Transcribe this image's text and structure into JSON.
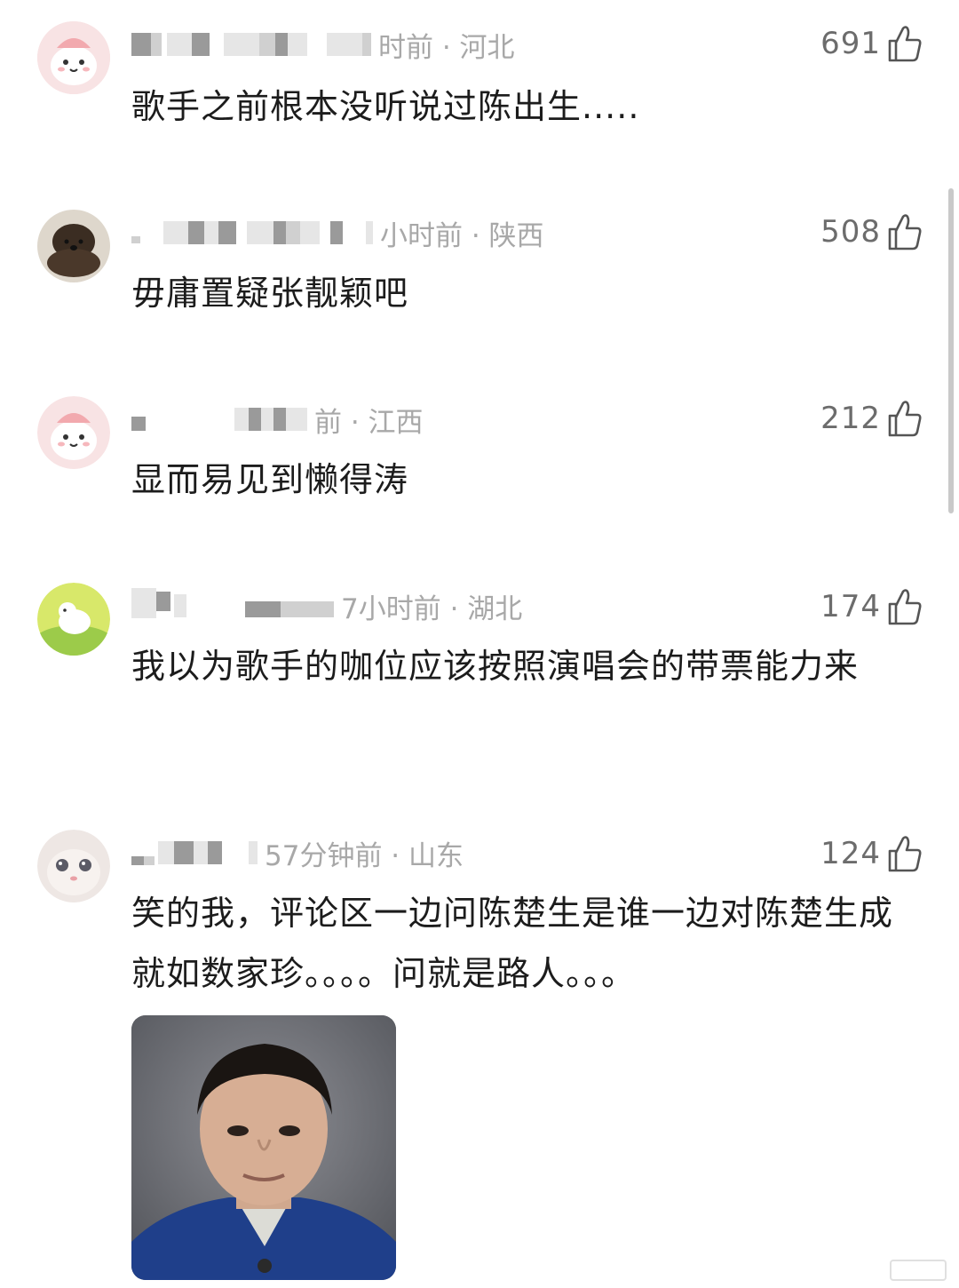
{
  "comments": [
    {
      "meta": "时前 · 河北",
      "likes": "691",
      "text": "歌手之前根本没听说过陈出生....."
    },
    {
      "meta": "小时前 · 陕西",
      "likes": "508",
      "text": "毋庸置疑张靓颖吧"
    },
    {
      "meta": "前 · 江西",
      "likes": "212",
      "text": "显而易见到懒得涛"
    },
    {
      "meta": "7小时前 · 湖北",
      "likes": "174",
      "text": "我以为歌手的咖位应该按照演唱会的带票能力来"
    },
    {
      "meta": "57分钟前 · 山东",
      "likes": "124",
      "text": "笑的我，评论区一边问陈楚生是谁一边对陈楚生成就如数家珍。。。。问就是路人。。。"
    }
  ],
  "icons": {
    "like": "thumbs-up-icon"
  },
  "colors": {
    "meta": "#a8a8a8",
    "likes": "#6c6c6c",
    "text": "#1c1c1c"
  }
}
